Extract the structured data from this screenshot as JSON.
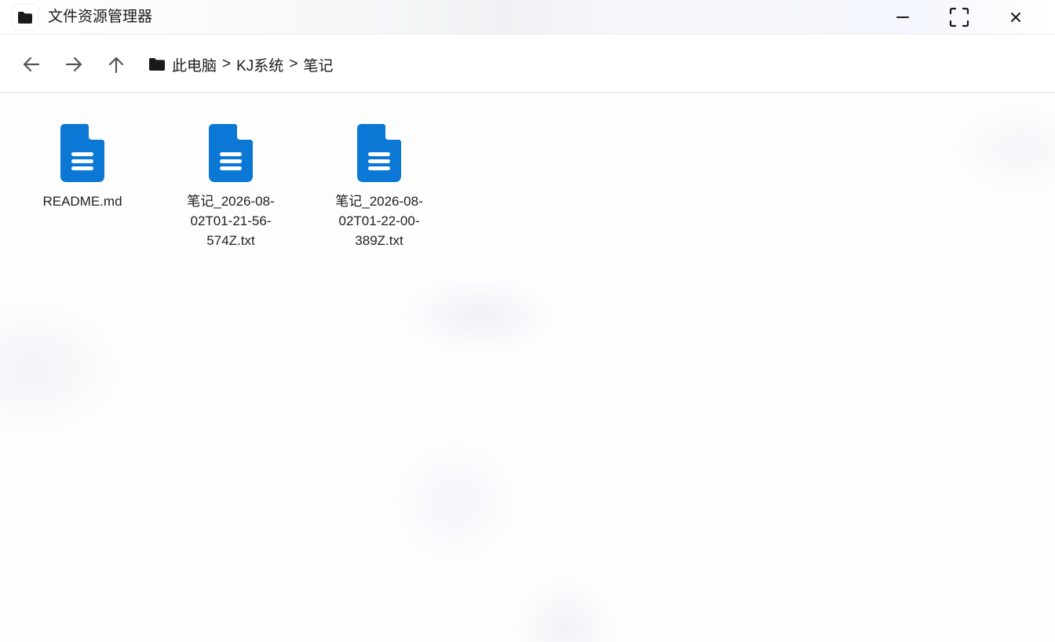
{
  "window": {
    "title": "文件资源管理器",
    "app_icon": "folder-icon",
    "controls": {
      "minimize_icon": "minimize-icon",
      "maximize_icon": "maximize-icon",
      "close_icon": "close-icon"
    }
  },
  "navigation": {
    "back_icon": "arrow-left-icon",
    "forward_icon": "arrow-right-icon",
    "up_icon": "arrow-up-icon",
    "breadcrumb": {
      "icon": "folder-icon",
      "items": [
        "此电脑",
        "KJ系统",
        "笔记"
      ],
      "separator": ">"
    }
  },
  "files": [
    {
      "name": "README.md",
      "icon": "document-icon"
    },
    {
      "name": "笔记_2026-08-02T01-21-56-574Z.txt",
      "icon": "document-icon"
    },
    {
      "name": "笔记_2026-08-02T01-22-00-389Z.txt",
      "icon": "document-icon"
    }
  ],
  "colors": {
    "file_icon": "#0a78d4",
    "text": "#1f1f1f",
    "icon_gray": "#555555"
  }
}
